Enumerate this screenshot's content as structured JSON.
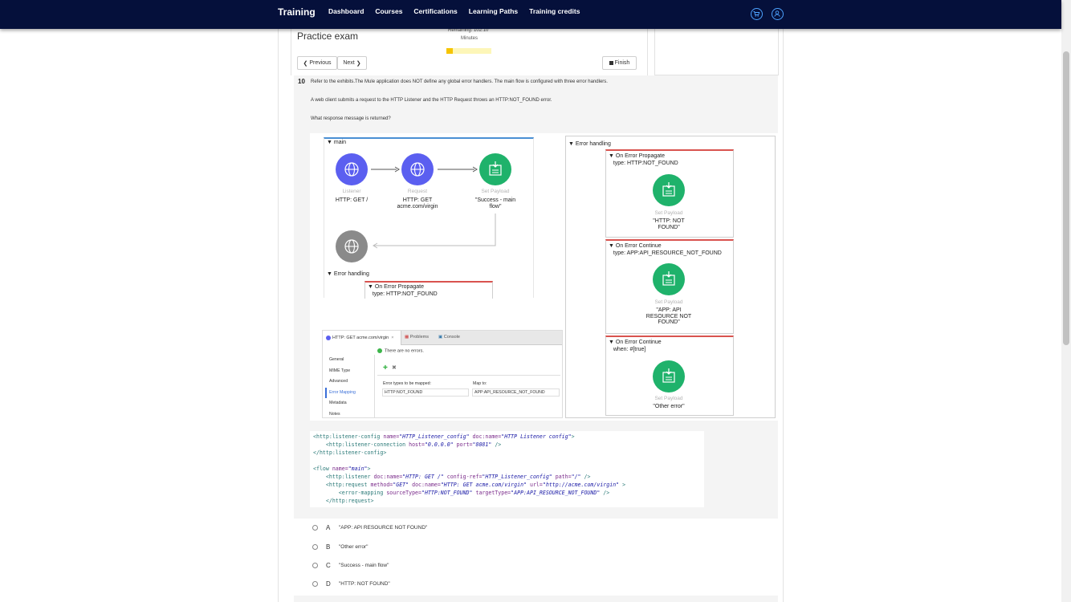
{
  "nav": {
    "brand": "Training",
    "links": [
      "Dashboard",
      "Courses",
      "Certifications",
      "Learning Paths",
      "Training credits"
    ]
  },
  "exam": {
    "title": "Practice exam",
    "remaining": "Remaining: 102:10",
    "minutes": "Minutes",
    "progress_fraction": 0.14,
    "prev_label": "Previous",
    "next_label": "Next",
    "finish_label": "Finish"
  },
  "question": {
    "number": "10",
    "text1": "Refer to the exhibits.The Mule application does NOT define any global error handlers. The main flow is configured with three error handlers.",
    "text2": "A web client submits a request to the HTTP Listener and the HTTP Request throws an HTTP:NOT_FOUND error.",
    "text3": "What response message is returned?"
  },
  "flow": {
    "main_label": "main",
    "listener_cap": "Listener",
    "listener_label": "HTTP: GET /",
    "request_cap": "Request",
    "request_label1": "HTTP: GET",
    "request_label2": "acme.com/virgin",
    "payload_cap": "Set Payload",
    "payload_label1": "\"Success - main",
    "payload_label2": "flow\"",
    "error_handling": "Error handling",
    "propagate_title": "On Error Propagate",
    "propagate_type": "type: HTTP:NOT_FOUND"
  },
  "handlers": {
    "title": "Error handling",
    "h1_title": "On Error Propagate",
    "h1_type": "type: HTTP:NOT_FOUND",
    "h1_cap": "Set Payload",
    "h1_l1": "\"HTTP: NOT",
    "h1_l2": "FOUND\"",
    "h2_title": "On Error Continue",
    "h2_type": "type: APP:API_RESOURCE_NOT_FOUND",
    "h2_cap": "Set Payload",
    "h2_l1": "\"APP: API",
    "h2_l2": "RESOURCE NOT",
    "h2_l3": "FOUND\"",
    "h3_title": "On Error Continue",
    "h3_type": "when: #[true]",
    "h3_cap": "Set Payload",
    "h3_l1": "\"Other error\""
  },
  "props": {
    "tab1": "HTTP: GET acme.com/virgin",
    "tab2": "Problems",
    "tab3": "Console",
    "status": "There are no errors.",
    "side": [
      "General",
      "MIME Type",
      "Advanced",
      "Error Mapping",
      "Metadata",
      "Notes"
    ],
    "col1": "Error types to be mapped:",
    "col2": "Map to:",
    "val1": "HTTP:NOT_FOUND",
    "val2": "APP:API_RESOURCE_NOT_FOUND"
  },
  "code": {
    "l1a": "<http:listener-config",
    "l1b": " name=",
    "l1c": "\"HTTP_Listener_config\"",
    "l1d": " doc:name=",
    "l1e": "\"HTTP Listener config\"",
    "l1f": ">",
    "l2a": "    <http:listener-connection",
    "l2b": " host=",
    "l2c": "\"0.0.0.0\"",
    "l2d": " port=",
    "l2e": "\"8081\"",
    "l2f": " />",
    "l3": "</http:listener-config>",
    "l4a": "<flow",
    "l4b": " name=",
    "l4c": "\"main\"",
    "l4d": ">",
    "l5a": "    <http:listener",
    "l5b": " doc:name=",
    "l5c": "\"HTTP: GET /\"",
    "l5d": " config-ref=",
    "l5e": "\"HTTP_Listener_config\"",
    "l5f": " path=",
    "l5g": "\"/\"",
    "l5h": " />",
    "l6a": "    <http:request",
    "l6b": " method=",
    "l6c": "\"GET\"",
    "l6d": " doc:name=",
    "l6e": "\"HTTP: GET acme.com/virgin\"",
    "l6f": " url=",
    "l6g": "\"http://acme.com/virgin\"",
    "l6h": " >",
    "l7a": "        <error-mapping",
    "l7b": " sourceType=",
    "l7c": "\"HTTP:NOT_FOUND\"",
    "l7d": " targetType=",
    "l7e": "\"APP:API_RESOURCE_NOT_FOUND\"",
    "l7f": " />",
    "l8": "    </http:request>"
  },
  "answers": [
    {
      "letter": "A",
      "text": "\"APP: API RESOURCE NOT FOUND\""
    },
    {
      "letter": "B",
      "text": "\"Other error\""
    },
    {
      "letter": "C",
      "text": "\"Success - main flow\""
    },
    {
      "letter": "D",
      "text": "\"HTTP: NOT FOUND\""
    }
  ],
  "colors": {
    "nav_bg": "#05103b",
    "flow_blue": "#5b5ff0",
    "payload_green": "#1fb26b",
    "error_red": "#d9534f"
  }
}
